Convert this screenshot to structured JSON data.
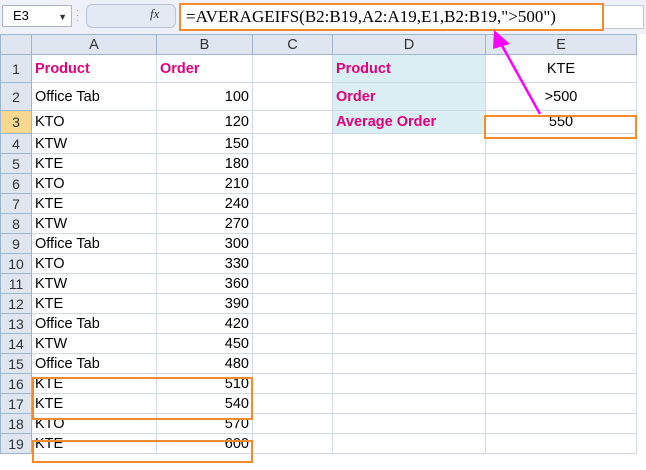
{
  "formula_bar": {
    "name_box": "E3",
    "fx_label": "fx",
    "formula": "=AVERAGEIFS(B2:B19,A2:A19,E1,B2:B19,\">500\")"
  },
  "columns": [
    "A",
    "B",
    "C",
    "D",
    "E"
  ],
  "rows": [
    {
      "n": "1",
      "a": "Product",
      "b": "Order",
      "d": "Product",
      "e": "KTE"
    },
    {
      "n": "2",
      "a": "Office Tab",
      "b": "100",
      "d": "Order",
      "e": ">500"
    },
    {
      "n": "3",
      "a": "KTO",
      "b": "120",
      "d": "Average Order",
      "e": "550"
    },
    {
      "n": "4",
      "a": "KTW",
      "b": "150",
      "d": "",
      "e": ""
    },
    {
      "n": "5",
      "a": "KTE",
      "b": "180",
      "d": "",
      "e": ""
    },
    {
      "n": "6",
      "a": "KTO",
      "b": "210",
      "d": "",
      "e": ""
    },
    {
      "n": "7",
      "a": "KTE",
      "b": "240",
      "d": "",
      "e": ""
    },
    {
      "n": "8",
      "a": "KTW",
      "b": "270",
      "d": "",
      "e": ""
    },
    {
      "n": "9",
      "a": "Office Tab",
      "b": "300",
      "d": "",
      "e": ""
    },
    {
      "n": "10",
      "a": "KTO",
      "b": "330",
      "d": "",
      "e": ""
    },
    {
      "n": "11",
      "a": "KTW",
      "b": "360",
      "d": "",
      "e": ""
    },
    {
      "n": "12",
      "a": "KTE",
      "b": "390",
      "d": "",
      "e": ""
    },
    {
      "n": "13",
      "a": "Office Tab",
      "b": "420",
      "d": "",
      "e": ""
    },
    {
      "n": "14",
      "a": "KTW",
      "b": "450",
      "d": "",
      "e": ""
    },
    {
      "n": "15",
      "a": "Office Tab",
      "b": "480",
      "d": "",
      "e": ""
    },
    {
      "n": "16",
      "a": "KTE",
      "b": "510",
      "d": "",
      "e": ""
    },
    {
      "n": "17",
      "a": "KTE",
      "b": "540",
      "d": "",
      "e": ""
    },
    {
      "n": "18",
      "a": "KTO",
      "b": "570",
      "d": "",
      "e": ""
    },
    {
      "n": "19",
      "a": "KTE",
      "b": "600",
      "d": "",
      "e": ""
    }
  ],
  "colors": {
    "header_text": "#e2007a",
    "highlight_border": "#f28a2e",
    "criteria_fill": "#daeef3",
    "arrow": "#ff00ff"
  }
}
